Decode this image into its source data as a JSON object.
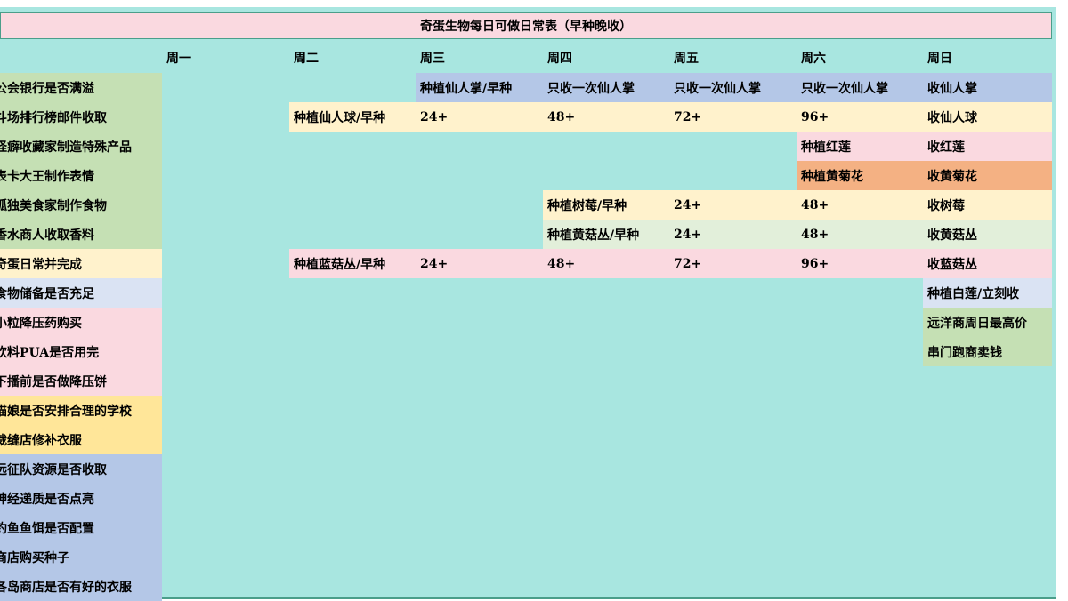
{
  "title": "奇蛋生物每日可做日常表（早种晚收）",
  "days": [
    "周一",
    "周二",
    "周三",
    "周四",
    "周五",
    "周六",
    "周日"
  ],
  "tasks": [
    "公会银行是否满溢",
    "斗场排行榜邮件收取",
    "怪癖收藏家制造特殊产品",
    "表卡大王制作表情",
    "孤独美食家制作食物",
    "香水商人收取香料",
    "奇蛋日常并完成",
    "食物储备是否充足",
    "小粒降压药购买",
    "饮料PUA是否用完",
    "下播前是否做降压饼",
    "猫娘是否安排合理的学校",
    "裁缝店修补衣服",
    "远征队资源是否收取",
    "神经递质是否点亮",
    "钓鱼鱼饵是否配置",
    "商店购买种子",
    "各岛商店是否有好的衣服"
  ],
  "schedule": {
    "row1": {
      "wed": "种植仙人掌/早种",
      "thu": "只收一次仙人掌",
      "fri": "只收一次仙人掌",
      "sat": "只收一次仙人掌",
      "sun": "收仙人掌"
    },
    "row2": {
      "tue": "种植仙人球/早种",
      "wed": "24+",
      "thu": "48+",
      "fri": "72+",
      "sat": "96+",
      "sun": "收仙人球"
    },
    "row3": {
      "sat": "种植红莲",
      "sun": "收红莲"
    },
    "row4": {
      "sat": "种植黄菊花",
      "sun": "收黄菊花"
    },
    "row5": {
      "thu": "种植树莓/早种",
      "fri": "24+",
      "sat": "48+",
      "sun": "收树莓"
    },
    "row6": {
      "thu": "种植黄菇丛/早种",
      "fri": "24+",
      "sat": "48+",
      "sun": "收黄菇丛"
    },
    "row7": {
      "tue": "种植蓝菇丛/早种",
      "wed": "24+",
      "thu": "48+",
      "fri": "72+",
      "sat": "96+",
      "sun": "收蓝菇丛"
    },
    "row8": {
      "sun": "种植白莲/立刻收"
    },
    "row9": {
      "sun": "远洋商周日最高价"
    },
    "row10": {
      "sun": "串门跑商卖钱"
    }
  },
  "colors": {
    "sheet_bg": "#a8e6e0",
    "title_bg": "#fad9e0",
    "blue": "#b4c7e7",
    "yellow": "#fff2cc",
    "green": "#c5e0b4",
    "pink": "#fad9e0",
    "orange": "#f4b183",
    "gold": "#ffe699"
  }
}
